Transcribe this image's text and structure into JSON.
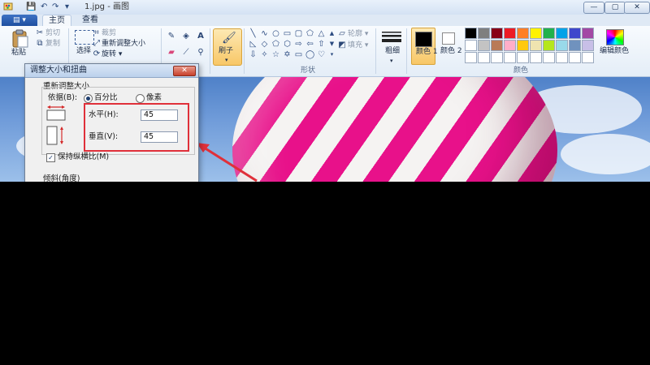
{
  "window": {
    "title": "1.jpg - 画图",
    "quick_access": [
      "💾",
      "↶",
      "↷",
      "▾"
    ]
  },
  "window_buttons": {
    "minimize": "—",
    "maximize": "▢",
    "close": "✕"
  },
  "tabs": {
    "file": "▤ ▾",
    "home": "主页",
    "view": "查看"
  },
  "ribbon": {
    "clipboard": {
      "paste": "粘贴",
      "cut": "剪切",
      "copy": "复制"
    },
    "image": {
      "select": "选择",
      "crop": "裁剪",
      "resize": "重新调整大小",
      "rotate": "旋转 ▾"
    },
    "tools": {
      "text_tool": "A"
    },
    "brushes": {
      "label": "刷子"
    },
    "shapes": {
      "outline": "轮廓 ▾",
      "fill": "填充 ▾",
      "group_label": "形状"
    },
    "size": {
      "label": "粗细"
    },
    "colors": {
      "color1": "颜色 1",
      "color2": "颜色 2",
      "edit": "编辑颜色",
      "group_label": "颜色",
      "palette_row1": [
        "#000000",
        "#7f7f7f",
        "#880015",
        "#ed1c24",
        "#ff7f27",
        "#fff200",
        "#22b14c",
        "#00a2e8",
        "#3f48cc",
        "#a349a4"
      ],
      "palette_row2": [
        "#ffffff",
        "#c3c3c3",
        "#b97a57",
        "#ffaec9",
        "#ffc90e",
        "#efe4b0",
        "#b5e61d",
        "#99d9ea",
        "#7092be",
        "#c8bfe7"
      ],
      "palette_row3": [
        "#ffffff",
        "#ffffff",
        "#ffffff",
        "#ffffff",
        "#ffffff",
        "#ffffff",
        "#ffffff",
        "#ffffff",
        "#ffffff",
        "#ffffff"
      ]
    }
  },
  "dialog": {
    "title": "调整大小和扭曲",
    "resize_section": "重新调整大小",
    "by_label": "依据(B):",
    "percent_label": "百分比",
    "pixels_label": "像素",
    "horizontal_label": "水平(H):",
    "horizontal_value": "45",
    "vertical_label": "垂直(V):",
    "vertical_value": "45",
    "keep_ratio_label": "保持纵横比(M)",
    "skew_section": "倾斜(角度)",
    "close": "✕"
  }
}
